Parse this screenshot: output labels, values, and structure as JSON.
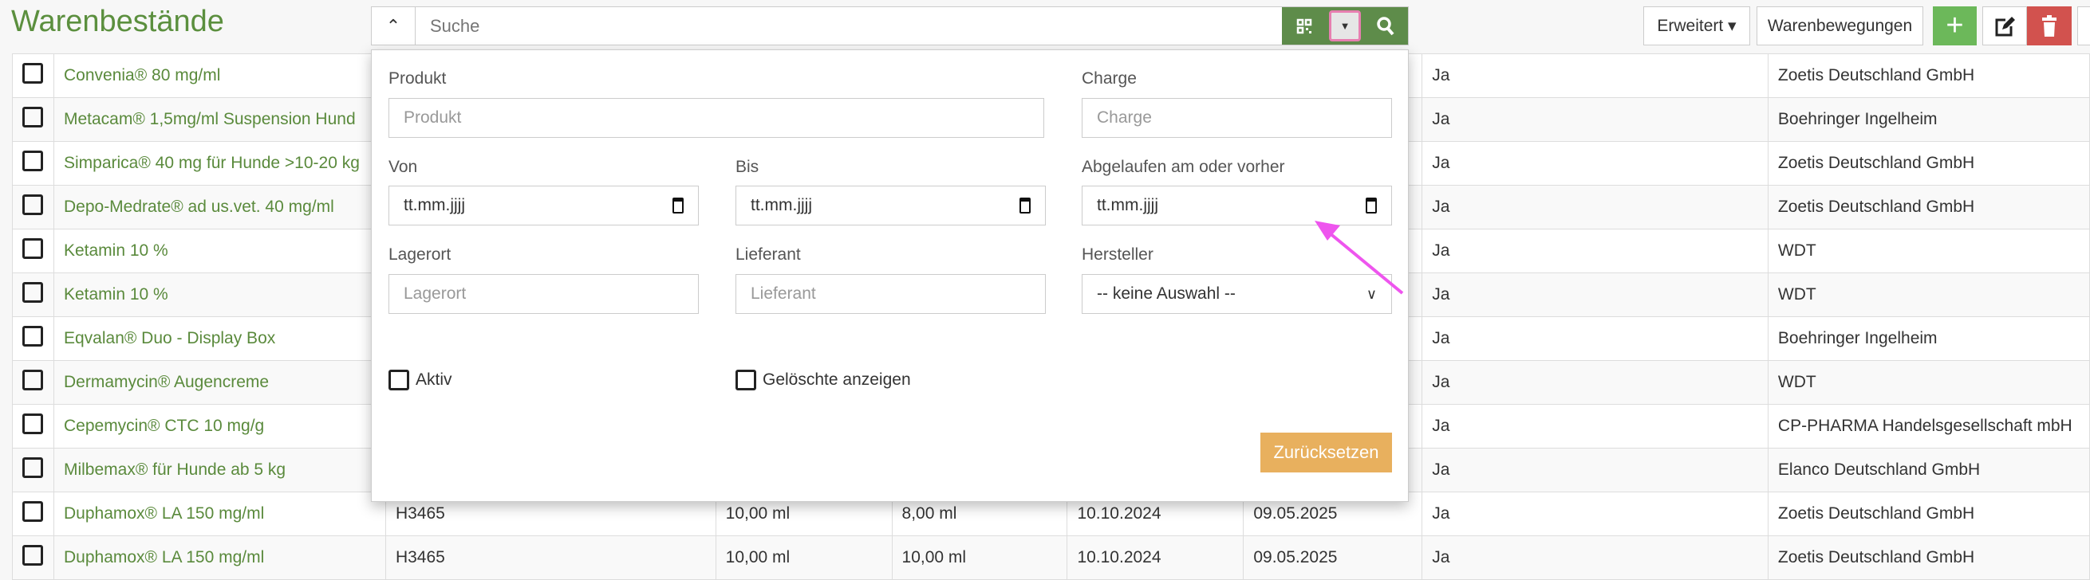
{
  "header": {
    "title": "Warenbestände",
    "search_placeholder": "Suche",
    "advanced_label": "Erweitert ▾",
    "movements_label": "Warenbewegungen"
  },
  "filter": {
    "produkt_label": "Produkt",
    "produkt_placeholder": "Produkt",
    "charge_label": "Charge",
    "charge_placeholder": "Charge",
    "von_label": "Von",
    "bis_label": "Bis",
    "abgelaufen_label": "Abgelaufen am oder vorher",
    "date_placeholder": "tt.mm.jjjj",
    "lagerort_label": "Lagerort",
    "lagerort_placeholder": "Lagerort",
    "lieferant_label": "Lieferant",
    "lieferant_placeholder": "Lieferant",
    "hersteller_label": "Hersteller",
    "hersteller_value": "-- keine Auswahl --",
    "aktiv_label": "Aktiv",
    "geloeschte_label": "Gelöschte anzeigen",
    "reset_label": "Zurücksetzen"
  },
  "colors": {
    "accent": "#5b8f3e",
    "warning": "#e8b05e",
    "danger": "#d2524e",
    "success": "#6cb85a",
    "annotation": "#ee55ee"
  },
  "rows": [
    {
      "name": "Convenia® 80 mg/ml",
      "charge": "",
      "menge": "",
      "rest": "",
      "datum": "",
      "ablauf": "",
      "aktiv": "Ja",
      "hersteller": "Zoetis Deutschland GmbH"
    },
    {
      "name": "Metacam® 1,5mg/ml Suspension Hund",
      "charge": "",
      "menge": "",
      "rest": "",
      "datum": "",
      "ablauf": "",
      "aktiv": "Ja",
      "hersteller": "Boehringer Ingelheim"
    },
    {
      "name": "Simparica® 40 mg für Hunde >10-20 kg",
      "charge": "",
      "menge": "",
      "rest": "",
      "datum": "",
      "ablauf": "",
      "aktiv": "Ja",
      "hersteller": "Zoetis Deutschland GmbH"
    },
    {
      "name": "Depo-Medrate® ad us.vet. 40 mg/ml",
      "charge": "",
      "menge": "",
      "rest": "",
      "datum": "",
      "ablauf": "",
      "aktiv": "Ja",
      "hersteller": "Zoetis Deutschland GmbH"
    },
    {
      "name": "Ketamin 10 %",
      "charge": "",
      "menge": "",
      "rest": "",
      "datum": "",
      "ablauf": "",
      "aktiv": "Ja",
      "hersteller": "WDT"
    },
    {
      "name": "Ketamin 10 %",
      "charge": "",
      "menge": "",
      "rest": "",
      "datum": "",
      "ablauf": "",
      "aktiv": "Ja",
      "hersteller": "WDT"
    },
    {
      "name": "Eqvalan® Duo - Display Box",
      "charge": "",
      "menge": "",
      "rest": "",
      "datum": "",
      "ablauf": "",
      "aktiv": "Ja",
      "hersteller": "Boehringer Ingelheim"
    },
    {
      "name": "Dermamycin® Augencreme",
      "charge": "",
      "menge": "",
      "rest": "",
      "datum": "",
      "ablauf": "",
      "aktiv": "Ja",
      "hersteller": "WDT"
    },
    {
      "name": "Cepemycin® CTC 10 mg/g",
      "charge": "",
      "menge": "",
      "rest": "",
      "datum": "",
      "ablauf": "",
      "aktiv": "Ja",
      "hersteller": "CP-PHARMA Handelsgesellschaft mbH"
    },
    {
      "name": "Milbemax® für Hunde ab 5 kg",
      "charge": "",
      "menge": "",
      "rest": "",
      "datum": "",
      "ablauf": "",
      "aktiv": "Ja",
      "hersteller": "Elanco Deutschland GmbH"
    },
    {
      "name": "Duphamox® LA 150 mg/ml",
      "charge": "H3465",
      "menge": "10,00 ml",
      "rest": "8,00 ml",
      "datum": "10.10.2024",
      "ablauf": "09.05.2025",
      "aktiv": "Ja",
      "hersteller": "Zoetis Deutschland GmbH"
    },
    {
      "name": "Duphamox® LA 150 mg/ml",
      "charge": "H3465",
      "menge": "10,00 ml",
      "rest": "10,00 ml",
      "datum": "10.10.2024",
      "ablauf": "09.05.2025",
      "aktiv": "Ja",
      "hersteller": "Zoetis Deutschland GmbH"
    }
  ]
}
